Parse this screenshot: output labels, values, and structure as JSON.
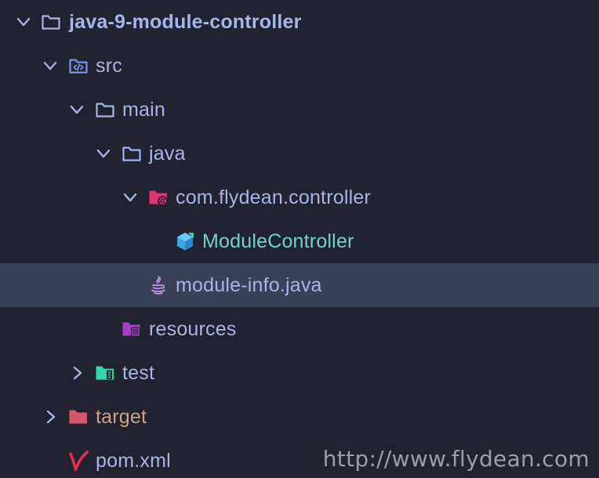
{
  "tree": {
    "root_label": "java-9-module-controller",
    "src_label": "src",
    "main_label": "main",
    "java_label": "java",
    "package_label": "com.flydean.controller",
    "class_label": "ModuleController",
    "module_info_label": "module-info.java",
    "resources_label": "resources",
    "test_label": "test",
    "target_label": "target",
    "pom_label": "pom.xml"
  },
  "watermark": "http://www.flydean.com",
  "colors": {
    "background": "#212430",
    "selected_row": "#3b4059",
    "text": "#a9b4e8",
    "class_text": "#6fd3c8",
    "target_text": "#d1a07f",
    "folder_outline": "#a9b4e8",
    "package_folder": "#e0356f",
    "resources_folder": "#a43fc4",
    "test_folder": "#2fd8a6",
    "target_folder": "#d8566a",
    "maven_icon": "#e82a4f"
  },
  "icons": {
    "expanded": "chevron-down-icon",
    "collapsed": "chevron-right-icon",
    "folder": "folder-icon",
    "source_folder": "source-folder-icon",
    "package": "package-folder-icon",
    "class": "java-class-icon",
    "java_file": "java-file-icon",
    "resources": "resources-folder-icon",
    "test": "test-folder-icon",
    "target": "target-folder-icon",
    "pom": "maven-icon"
  }
}
